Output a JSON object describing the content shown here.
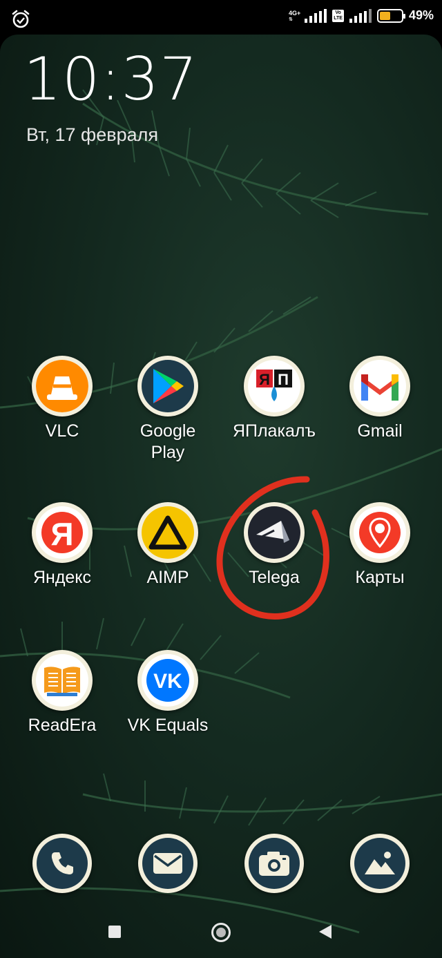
{
  "status_bar": {
    "network_label": "4G+",
    "volte_top": "Vo",
    "volte_bottom": "LTE",
    "battery_percent": "49%",
    "battery_level": 0.49,
    "battery_color": "#f2b01e"
  },
  "lockclock": {
    "time": "10:37",
    "date": "Вт, 17 февраля"
  },
  "apps": [
    {
      "label": "VLC",
      "icon": "vlc-icon"
    },
    {
      "label": "Google\nPlay",
      "icon": "google-play-icon"
    },
    {
      "label": "ЯПлакалъ",
      "icon": "yaplakal-icon"
    },
    {
      "label": "Gmail",
      "icon": "gmail-icon"
    },
    {
      "label": "Яндекс",
      "icon": "yandex-icon"
    },
    {
      "label": "AIMP",
      "icon": "aimp-icon"
    },
    {
      "label": "Telega",
      "icon": "telega-icon"
    },
    {
      "label": "Карты",
      "icon": "maps-icon"
    },
    {
      "label": "ReadEra",
      "icon": "readera-icon"
    },
    {
      "label": "VK Equals",
      "icon": "vk-icon"
    }
  ],
  "dock": [
    {
      "icon": "phone-icon"
    },
    {
      "icon": "messages-icon"
    },
    {
      "icon": "camera-icon"
    },
    {
      "icon": "gallery-icon"
    }
  ],
  "annotation_color": "#e0301e"
}
